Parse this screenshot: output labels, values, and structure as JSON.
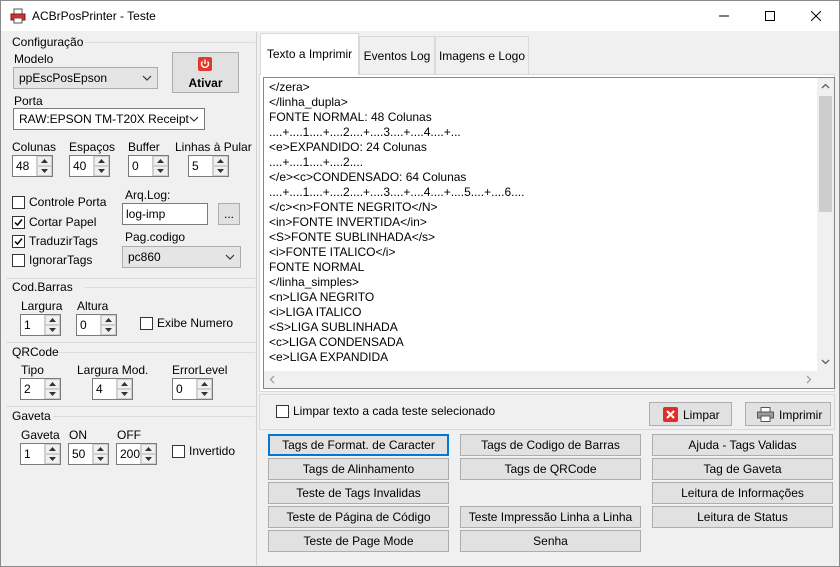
{
  "window": {
    "title": "ACBrPosPrinter - Teste"
  },
  "config": {
    "group_label": "Configuração",
    "modelo_label": "Modelo",
    "modelo_value": "ppEscPosEpson",
    "ativar_label": "Ativar",
    "porta_label": "Porta",
    "porta_value": "RAW:EPSON TM-T20X Receipt",
    "colunas_label": "Colunas",
    "colunas_value": "48",
    "espacos_label": "Espaços",
    "espacos_value": "40",
    "buffer_label": "Buffer",
    "buffer_value": "0",
    "linhas_label": "Linhas à Pular",
    "linhas_value": "5",
    "controle_porta_label": "Controle Porta",
    "cortar_papel_label": "Cortar Papel",
    "traduzir_tags_label": "TraduzirTags",
    "ignorar_tags_label": "IgnorarTags",
    "arqlog_label": "Arq.Log:",
    "arqlog_value": "log-imp",
    "browse_label": "...",
    "pagcodigo_label": "Pag.codigo",
    "pagcodigo_value": "pc860"
  },
  "codbarras": {
    "group_label": "Cod.Barras",
    "largura_label": "Largura",
    "largura_value": "1",
    "altura_label": "Altura",
    "altura_value": "0",
    "exibe_numero_label": "Exibe Numero"
  },
  "qrcode": {
    "group_label": "QRCode",
    "tipo_label": "Tipo",
    "tipo_value": "2",
    "largura_mod_label": "Largura Mod.",
    "largura_mod_value": "4",
    "error_level_label": "ErrorLevel",
    "error_level_value": "0"
  },
  "gaveta": {
    "group_label": "Gaveta",
    "gaveta_label": "Gaveta",
    "gaveta_value": "1",
    "on_label": "ON",
    "on_value": "50",
    "off_label": "OFF",
    "off_value": "200",
    "invertido_label": "Invertido"
  },
  "tabs": [
    {
      "label": "Texto a Imprimir"
    },
    {
      "label": "Eventos Log"
    },
    {
      "label": "Imagens e Logo"
    }
  ],
  "memo_lines": [
    "</zera>",
    "</linha_dupla>",
    "FONTE NORMAL: 48 Colunas",
    "....+....1....+....2....+....3....+....4....+...",
    "<e>EXPANDIDO: 24 Colunas",
    "....+....1....+....2....",
    "</e><c>CONDENSADO: 64 Colunas",
    "....+....1....+....2....+....3....+....4....+....5....+....6....",
    "</c><n>FONTE NEGRITO</N>",
    "<in>FONTE INVERTIDA</in>",
    "<S>FONTE SUBLINHADA</s>",
    "<i>FONTE ITALICO</i>",
    "FONTE NORMAL",
    "</linha_simples>",
    "<n>LIGA NEGRITO",
    "<i>LIGA ITALICO",
    "<S>LIGA SUBLINHADA",
    "<c>LIGA CONDENSADA",
    "<e>LIGA EXPANDIDA"
  ],
  "actions": {
    "limpar_texto_label": "Limpar texto a cada teste selecionado",
    "limpar_label": "Limpar",
    "imprimir_label": "Imprimir"
  },
  "tag_buttons": {
    "format_caracter": "Tags de Format. de Caracter",
    "codigo_barras": "Tags de Codigo de Barras",
    "ajuda_tags": "Ajuda - Tags Validas",
    "alinhamento": "Tags de Alinhamento",
    "qrcode": "Tags de QRCode",
    "gaveta": "Tag de Gaveta",
    "tags_invalidas": "Teste de Tags Invalidas",
    "leitura_info": "Leitura de Informações",
    "pagina_codigo": "Teste de Página de Código",
    "impressao_linha": "Teste Impressão Linha a Linha",
    "leitura_status": "Leitura de Status",
    "page_mode": "Teste de Page Mode",
    "senha": "Senha"
  }
}
